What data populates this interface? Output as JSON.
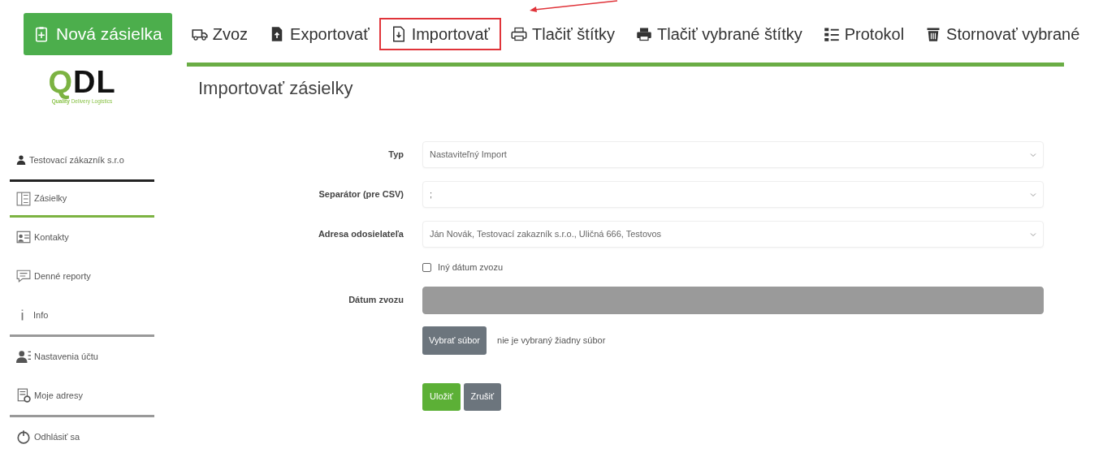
{
  "toolbar": {
    "primary": {
      "label": "Nová zásielka"
    },
    "items": [
      {
        "label": "Zvoz",
        "highlighted": false
      },
      {
        "label": "Exportovať",
        "highlighted": false
      },
      {
        "label": "Importovať",
        "highlighted": true
      },
      {
        "label": "Tlačiť štítky",
        "highlighted": false
      },
      {
        "label": "Tlačiť vybrané štítky",
        "highlighted": false
      },
      {
        "label": "Protokol",
        "highlighted": false
      },
      {
        "label": "Stornovať vybrané",
        "highlighted": false
      }
    ]
  },
  "logo": {
    "text": "QDL",
    "tagline": "**Quality** Delivery Logistics"
  },
  "sidebar": {
    "user": "Testovací zákazník s.r.o",
    "groups": [
      [
        {
          "label": "Zásielky",
          "selected": true
        },
        {
          "label": "Kontakty",
          "selected": false
        },
        {
          "label": "Denné reporty",
          "selected": false
        },
        {
          "label": "Info",
          "selected": false
        }
      ],
      [
        {
          "label": "Nastavenia účtu",
          "selected": false
        },
        {
          "label": "Moje adresy",
          "selected": false
        }
      ],
      [
        {
          "label": "Odhlásiť sa",
          "selected": false
        }
      ]
    ]
  },
  "form": {
    "title": "Importovať zásielky",
    "rows": [
      {
        "kind": "select",
        "label": "Typ",
        "value": "Nastaviteľný Import"
      },
      {
        "kind": "select",
        "label": "Separátor (pre CSV)",
        "value": ";"
      },
      {
        "kind": "select",
        "label": "Adresa odosielateľa",
        "value": "Ján Novák, Testovací zakazník s.r.o., Uličná 666, Testovos"
      },
      {
        "kind": "checkbox",
        "label": "Iný dátum zvozu",
        "checked": false
      },
      {
        "kind": "input",
        "label": "Dátum zvozu",
        "disabled": true
      },
      {
        "kind": "file",
        "button": "Vybrať súbor",
        "status": "nie je vybraný žiadny súbor"
      }
    ],
    "buttons": [
      {
        "label": "Uložiť",
        "kind": "primary"
      },
      {
        "label": "Zrušiť",
        "kind": "secondary"
      }
    ]
  }
}
